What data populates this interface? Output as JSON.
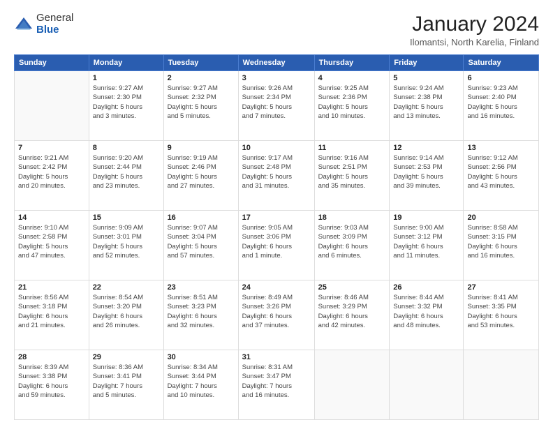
{
  "logo": {
    "general": "General",
    "blue": "Blue"
  },
  "header": {
    "title": "January 2024",
    "subtitle": "Ilomantsi, North Karelia, Finland"
  },
  "weekdays": [
    "Sunday",
    "Monday",
    "Tuesday",
    "Wednesday",
    "Thursday",
    "Friday",
    "Saturday"
  ],
  "weeks": [
    [
      {
        "day": "",
        "info": ""
      },
      {
        "day": "1",
        "info": "Sunrise: 9:27 AM\nSunset: 2:30 PM\nDaylight: 5 hours\nand 3 minutes."
      },
      {
        "day": "2",
        "info": "Sunrise: 9:27 AM\nSunset: 2:32 PM\nDaylight: 5 hours\nand 5 minutes."
      },
      {
        "day": "3",
        "info": "Sunrise: 9:26 AM\nSunset: 2:34 PM\nDaylight: 5 hours\nand 7 minutes."
      },
      {
        "day": "4",
        "info": "Sunrise: 9:25 AM\nSunset: 2:36 PM\nDaylight: 5 hours\nand 10 minutes."
      },
      {
        "day": "5",
        "info": "Sunrise: 9:24 AM\nSunset: 2:38 PM\nDaylight: 5 hours\nand 13 minutes."
      },
      {
        "day": "6",
        "info": "Sunrise: 9:23 AM\nSunset: 2:40 PM\nDaylight: 5 hours\nand 16 minutes."
      }
    ],
    [
      {
        "day": "7",
        "info": "Sunrise: 9:21 AM\nSunset: 2:42 PM\nDaylight: 5 hours\nand 20 minutes."
      },
      {
        "day": "8",
        "info": "Sunrise: 9:20 AM\nSunset: 2:44 PM\nDaylight: 5 hours\nand 23 minutes."
      },
      {
        "day": "9",
        "info": "Sunrise: 9:19 AM\nSunset: 2:46 PM\nDaylight: 5 hours\nand 27 minutes."
      },
      {
        "day": "10",
        "info": "Sunrise: 9:17 AM\nSunset: 2:48 PM\nDaylight: 5 hours\nand 31 minutes."
      },
      {
        "day": "11",
        "info": "Sunrise: 9:16 AM\nSunset: 2:51 PM\nDaylight: 5 hours\nand 35 minutes."
      },
      {
        "day": "12",
        "info": "Sunrise: 9:14 AM\nSunset: 2:53 PM\nDaylight: 5 hours\nand 39 minutes."
      },
      {
        "day": "13",
        "info": "Sunrise: 9:12 AM\nSunset: 2:56 PM\nDaylight: 5 hours\nand 43 minutes."
      }
    ],
    [
      {
        "day": "14",
        "info": "Sunrise: 9:10 AM\nSunset: 2:58 PM\nDaylight: 5 hours\nand 47 minutes."
      },
      {
        "day": "15",
        "info": "Sunrise: 9:09 AM\nSunset: 3:01 PM\nDaylight: 5 hours\nand 52 minutes."
      },
      {
        "day": "16",
        "info": "Sunrise: 9:07 AM\nSunset: 3:04 PM\nDaylight: 5 hours\nand 57 minutes."
      },
      {
        "day": "17",
        "info": "Sunrise: 9:05 AM\nSunset: 3:06 PM\nDaylight: 6 hours\nand 1 minute."
      },
      {
        "day": "18",
        "info": "Sunrise: 9:03 AM\nSunset: 3:09 PM\nDaylight: 6 hours\nand 6 minutes."
      },
      {
        "day": "19",
        "info": "Sunrise: 9:00 AM\nSunset: 3:12 PM\nDaylight: 6 hours\nand 11 minutes."
      },
      {
        "day": "20",
        "info": "Sunrise: 8:58 AM\nSunset: 3:15 PM\nDaylight: 6 hours\nand 16 minutes."
      }
    ],
    [
      {
        "day": "21",
        "info": "Sunrise: 8:56 AM\nSunset: 3:18 PM\nDaylight: 6 hours\nand 21 minutes."
      },
      {
        "day": "22",
        "info": "Sunrise: 8:54 AM\nSunset: 3:20 PM\nDaylight: 6 hours\nand 26 minutes."
      },
      {
        "day": "23",
        "info": "Sunrise: 8:51 AM\nSunset: 3:23 PM\nDaylight: 6 hours\nand 32 minutes."
      },
      {
        "day": "24",
        "info": "Sunrise: 8:49 AM\nSunset: 3:26 PM\nDaylight: 6 hours\nand 37 minutes."
      },
      {
        "day": "25",
        "info": "Sunrise: 8:46 AM\nSunset: 3:29 PM\nDaylight: 6 hours\nand 42 minutes."
      },
      {
        "day": "26",
        "info": "Sunrise: 8:44 AM\nSunset: 3:32 PM\nDaylight: 6 hours\nand 48 minutes."
      },
      {
        "day": "27",
        "info": "Sunrise: 8:41 AM\nSunset: 3:35 PM\nDaylight: 6 hours\nand 53 minutes."
      }
    ],
    [
      {
        "day": "28",
        "info": "Sunrise: 8:39 AM\nSunset: 3:38 PM\nDaylight: 6 hours\nand 59 minutes."
      },
      {
        "day": "29",
        "info": "Sunrise: 8:36 AM\nSunset: 3:41 PM\nDaylight: 7 hours\nand 5 minutes."
      },
      {
        "day": "30",
        "info": "Sunrise: 8:34 AM\nSunset: 3:44 PM\nDaylight: 7 hours\nand 10 minutes."
      },
      {
        "day": "31",
        "info": "Sunrise: 8:31 AM\nSunset: 3:47 PM\nDaylight: 7 hours\nand 16 minutes."
      },
      {
        "day": "",
        "info": ""
      },
      {
        "day": "",
        "info": ""
      },
      {
        "day": "",
        "info": ""
      }
    ]
  ]
}
